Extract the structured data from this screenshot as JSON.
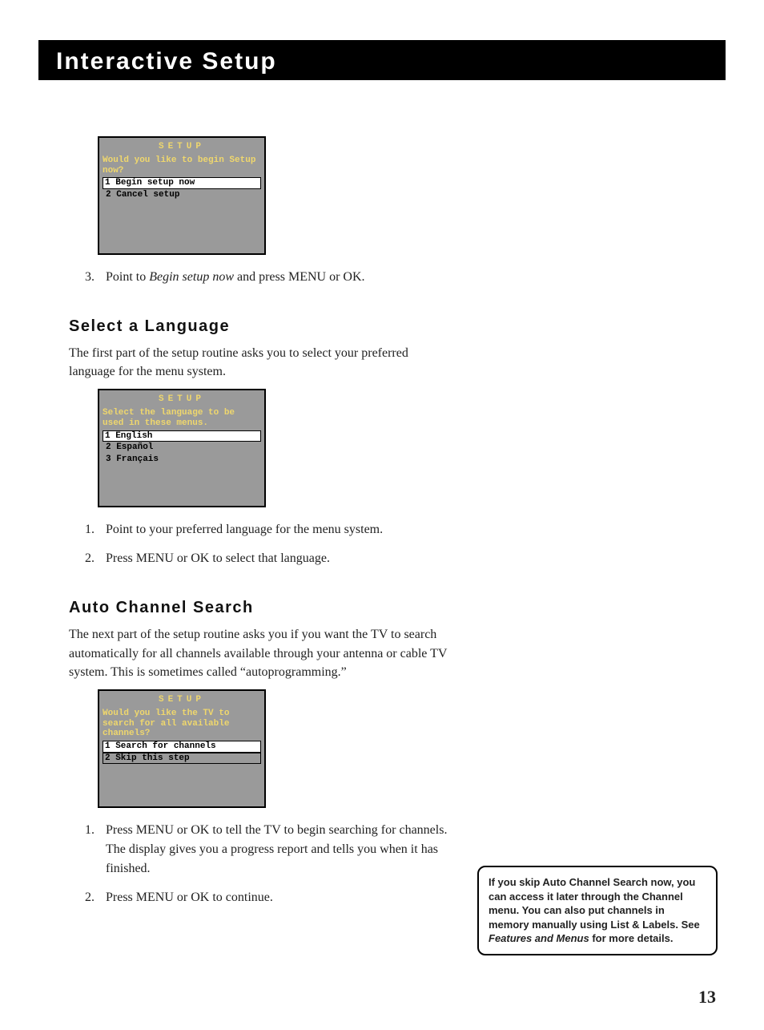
{
  "header": {
    "title": "Interactive Setup"
  },
  "osd_begin": {
    "title": "SETUP",
    "prompt": "Would you like to begin Setup now?",
    "opt1_num": "1",
    "opt1_label": "Begin setup now",
    "opt2_num": "2",
    "opt2_label": "Cancel setup"
  },
  "step_begin": {
    "num": "3.",
    "text_pre": "Point to ",
    "text_em": "Begin setup now",
    "text_post": " and press MENU or OK."
  },
  "lang": {
    "heading": "Select a Language",
    "body": "The first part of the setup routine asks you to select your preferred language for the menu system."
  },
  "osd_lang": {
    "title": "SETUP",
    "prompt": "Select the language to be used in these menus.",
    "opt1": "1 English",
    "opt2": "2 Español",
    "opt3": "3 Français"
  },
  "lang_steps": {
    "s1": "Point to your preferred language for the menu system.",
    "s2": "Press MENU or OK to select that language."
  },
  "auto": {
    "heading": "Auto Channel Search",
    "body": "The next part of the setup routine asks you if you want the TV to search automatically for all channels available through your antenna or cable TV system. This is sometimes called “autoprogramming.”"
  },
  "osd_auto": {
    "title": "SETUP",
    "prompt": "Would you like the TV to search for all available channels?",
    "opt1": "1 Search for channels",
    "opt2": "2 Skip this step"
  },
  "auto_steps": {
    "s1": "Press MENU or OK to tell the TV to begin searching for channels. The display gives you a progress report and tells you when it has finished.",
    "s2": "Press MENU or OK to continue."
  },
  "note": {
    "t1": "If you skip Auto Channel Search now, you can access it later through the Channel menu. You can also put channels in memory manually using List & Labels. See ",
    "t2": "Features and Menus",
    "t3": " for more details."
  },
  "page_number": "13"
}
